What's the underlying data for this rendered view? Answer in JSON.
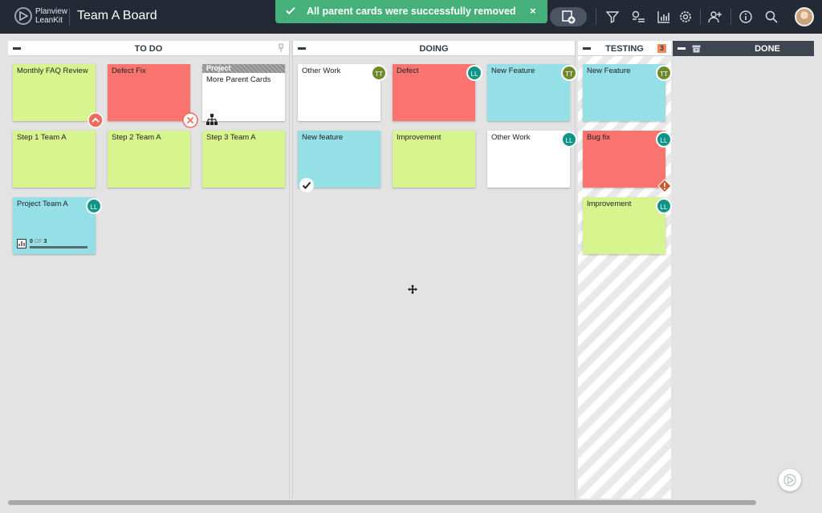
{
  "app": {
    "brand_line1": "Planview",
    "brand_line2": "LeanKit",
    "board_title": "Team A Board"
  },
  "toast": {
    "message": "All parent cards were successfully removed",
    "close_glyph": "×"
  },
  "header_icons": [
    "add-card-icon",
    "filter-icon",
    "card-list-icon",
    "reports-icon",
    "settings-icon",
    "add-user-icon",
    "info-icon",
    "search-icon"
  ],
  "lanes": {
    "todo": {
      "title": "TO DO"
    },
    "doing": {
      "title": "DOING"
    },
    "testing": {
      "title": "TESTING",
      "wip": "3"
    },
    "done": {
      "title": "DONE"
    }
  },
  "cards": {
    "todo_monthly_faq": {
      "title": "Monthly FAQ Review",
      "color": "#d7f48f"
    },
    "todo_defect_fix": {
      "title": "Defect Fix",
      "color": "#fc746f"
    },
    "todo_more_parent": {
      "type": "Project",
      "title": "More Parent Cards",
      "color": "#ffffff"
    },
    "todo_step1": {
      "title": "Step 1 Team A",
      "color": "#d7f48f"
    },
    "todo_step2": {
      "title": "Step 2 Team A",
      "color": "#d7f48f"
    },
    "todo_step3": {
      "title": "Step 3 Team A",
      "color": "#d7f48f"
    },
    "todo_project": {
      "title": "Project Team A",
      "color": "#95dfe7",
      "assignee": "LL",
      "progress": {
        "done": "0",
        "of": "OF",
        "total": "3",
        "fraction": 0
      }
    },
    "doing_other_work": {
      "title": "Other Work",
      "color": "#ffffff",
      "assignee": "TT"
    },
    "doing_defect": {
      "title": "Defect",
      "color": "#fc746f",
      "assignee": "LL"
    },
    "doing_new_feature": {
      "title": "New Feature",
      "color": "#95dfe7",
      "assignee": "TT"
    },
    "doing_new_feature2": {
      "title": "New feature",
      "color": "#95dfe7"
    },
    "doing_improvement": {
      "title": "Improvement",
      "color": "#d7f48f"
    },
    "doing_other_work2": {
      "title": "Other Work",
      "color": "#ffffff",
      "assignee": "LL"
    },
    "testing_new_feature": {
      "title": "New Feature",
      "color": "#95dfe7",
      "assignee": "TT"
    },
    "testing_bug_fix": {
      "title": "Bug fix",
      "color": "#fc746f",
      "assignee": "LL"
    },
    "testing_improvement": {
      "title": "Improvement",
      "color": "#d7f48f",
      "assignee": "LL"
    }
  }
}
